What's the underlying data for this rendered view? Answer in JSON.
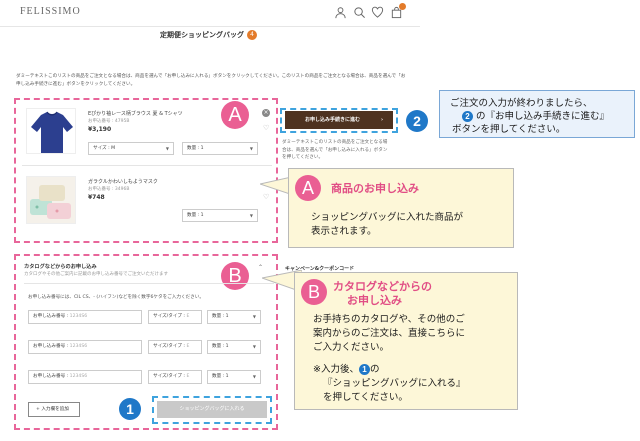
{
  "header": {
    "logo": "FELISSIMO",
    "page_title": "定期便ショッピングバッグ",
    "cart_count": "4"
  },
  "intro_text": "ダミーテキストこのリストの商品をご注文となる場合は、商品を選んで「お申し込みに入れる」ボタンをクリックしてください。このリストの商品をご注文となる場合は、商品を選んで「お申し込み手続きに進む」ボタンをクリックしてください。",
  "products": [
    {
      "name": "Eぴかり袖レース柄ブラウス 夏 & Tシャツ",
      "code": "お申込番号 : 4795B",
      "price": "¥3,190",
      "size_label": "サイズ : M",
      "qty_label": "数量 : 1"
    },
    {
      "name": "ガラクルかわいしもようマスク",
      "code": "お申込番号 : 3496B",
      "price": "¥748",
      "qty_label": "数量 : 1"
    }
  ],
  "proceed_button": "お申し込み手続きに進む",
  "side_note": "ダミーテキストこのリストの商品をご注文となる場合は、商品を選んで「お申し込みに入れる」ボタンを押してください。",
  "catalog": {
    "title": "カタログなどからのお申し込み",
    "subtitle": "カタログやその他ご案内に記載のお申し込み番号でご注文いただけます",
    "instruction": "お申し込み番号には、CIL CS、- (ハイフン)などを除く数字6ケタをご入力ください。",
    "rows": [
      {
        "num_label": "お申し込み番号 :",
        "num_ph": "1234S6",
        "size_label": "サイズ/タイプ :",
        "size_ph": "E",
        "qty": "数量 : 1"
      },
      {
        "num_label": "お申し込み番号 :",
        "num_ph": "1234S6",
        "size_label": "サイズ/タイプ :",
        "size_ph": "E",
        "qty": "数量 : 1"
      },
      {
        "num_label": "お申し込み番号 :",
        "num_ph": "1234S6",
        "size_label": "サイズ/タイプ :",
        "size_ph": "E",
        "qty": "数量 : 1"
      }
    ],
    "add_button": "入力欄を追加",
    "add_to_bag": "ショッピングバッグに入れる"
  },
  "campaign_label": "キャンペーン&クーポンコード",
  "markers": {
    "a": "A",
    "b": "B",
    "one": "1",
    "two": "2"
  },
  "callout_blue": {
    "line1": "ご注文の入力が終わりましたら、",
    "line2": "の『お申し込み手続きに進む』",
    "line3": "ボタンを押してください。"
  },
  "callout_a": {
    "title": "商品のお申し込み",
    "line1": "ショッピングバッグに入れた商品が",
    "line2": "表示されます。"
  },
  "callout_b": {
    "title1": "カタログなどからの",
    "title2": "お申し込み",
    "line1": "お手持ちのカタログや、その他のご",
    "line2": "案内からのご注文は、直接こちらに",
    "line3": "ご入力ください。",
    "line4a": "※入力後、",
    "line4b": "の",
    "line5": "『ショッピングバッグに入れる』",
    "line6": "を押してください。"
  },
  "colors": {
    "accent_pink": "#e8669a",
    "accent_blue": "#3ea3de",
    "proceed_brown": "#4e3220",
    "badge_orange": "#e37b2a"
  }
}
